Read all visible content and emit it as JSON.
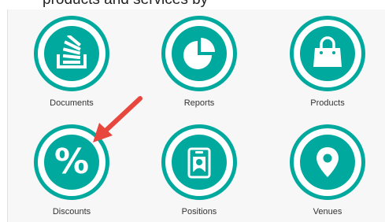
{
  "header": {
    "partial_text": "products and services by"
  },
  "tiles": [
    {
      "label": "Documents",
      "icon": "stack-icon"
    },
    {
      "label": "Reports",
      "icon": "pie-chart-icon"
    },
    {
      "label": "Products",
      "icon": "shopping-bag-icon"
    },
    {
      "label": "Discounts",
      "icon": "percent-icon"
    },
    {
      "label": "Positions",
      "icon": "id-badge-icon"
    },
    {
      "label": "Venues",
      "icon": "map-pin-icon"
    }
  ],
  "colors": {
    "accent": "#00a99d",
    "arrow": "#e8473e",
    "panel_bg": "#f7f7f7"
  }
}
